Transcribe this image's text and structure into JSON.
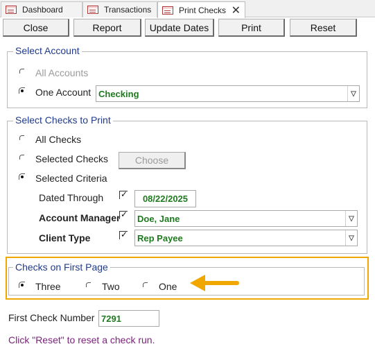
{
  "tabs": [
    {
      "label": "Dashboard",
      "icon": "form-icon"
    },
    {
      "label": "Transactions",
      "icon": "form-icon"
    },
    {
      "label": "Print Checks",
      "icon": "form-icon",
      "active": true
    }
  ],
  "toolbar": {
    "close_label": "Close",
    "report_label": "Report",
    "update_dates_label": "Update Dates",
    "print_label": "Print",
    "reset_label": "Reset"
  },
  "select_account": {
    "title": "Select Account",
    "all_accounts_label": "All Accounts",
    "one_account_label": "One Account",
    "account_value": "Checking",
    "selected": "One Account"
  },
  "select_checks": {
    "title": "Select Checks to Print",
    "all_checks_label": "All Checks",
    "selected_checks_label": "Selected Checks",
    "choose_label": "Choose",
    "selected_criteria_label": "Selected Criteria",
    "selected": "Selected Criteria",
    "dated_through_label": "Dated Through",
    "dated_through_value": "08/22/2025",
    "account_manager_label": "Account Manager",
    "account_manager_value": "Doe, Jane",
    "client_type_label": "Client Type",
    "client_type_value": "Rep Payee"
  },
  "checks_first_page": {
    "title": "Checks on First Page",
    "three_label": "Three",
    "two_label": "Two",
    "one_label": "One",
    "selected": "Three"
  },
  "first_check": {
    "label": "First Check Number",
    "value": "7291"
  },
  "hint": "Click \"Reset\" to reset a check run.",
  "colors": {
    "legend": "#1f3a8a",
    "value_green": "#1e7a1e",
    "hint_purple": "#7a1f7a",
    "highlight": "#f0a800"
  }
}
